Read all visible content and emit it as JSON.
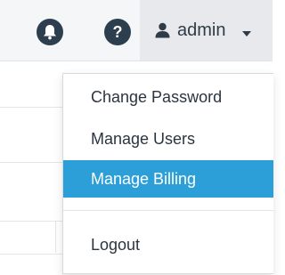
{
  "header": {
    "notifications_icon": "bell-icon",
    "help_icon": "question-icon",
    "help_glyph": "?",
    "user": {
      "icon": "user-icon",
      "name": "admin"
    }
  },
  "user_menu": {
    "items": [
      {
        "label": "Change Password",
        "active": false
      },
      {
        "label": "Manage Users",
        "active": false
      },
      {
        "label": "Manage Billing",
        "active": true
      },
      {
        "label": "Logout",
        "active": false
      }
    ]
  },
  "colors": {
    "accent": "#2c9fd9",
    "icon_bg": "#2d3e4f",
    "text": "#2b3540"
  }
}
